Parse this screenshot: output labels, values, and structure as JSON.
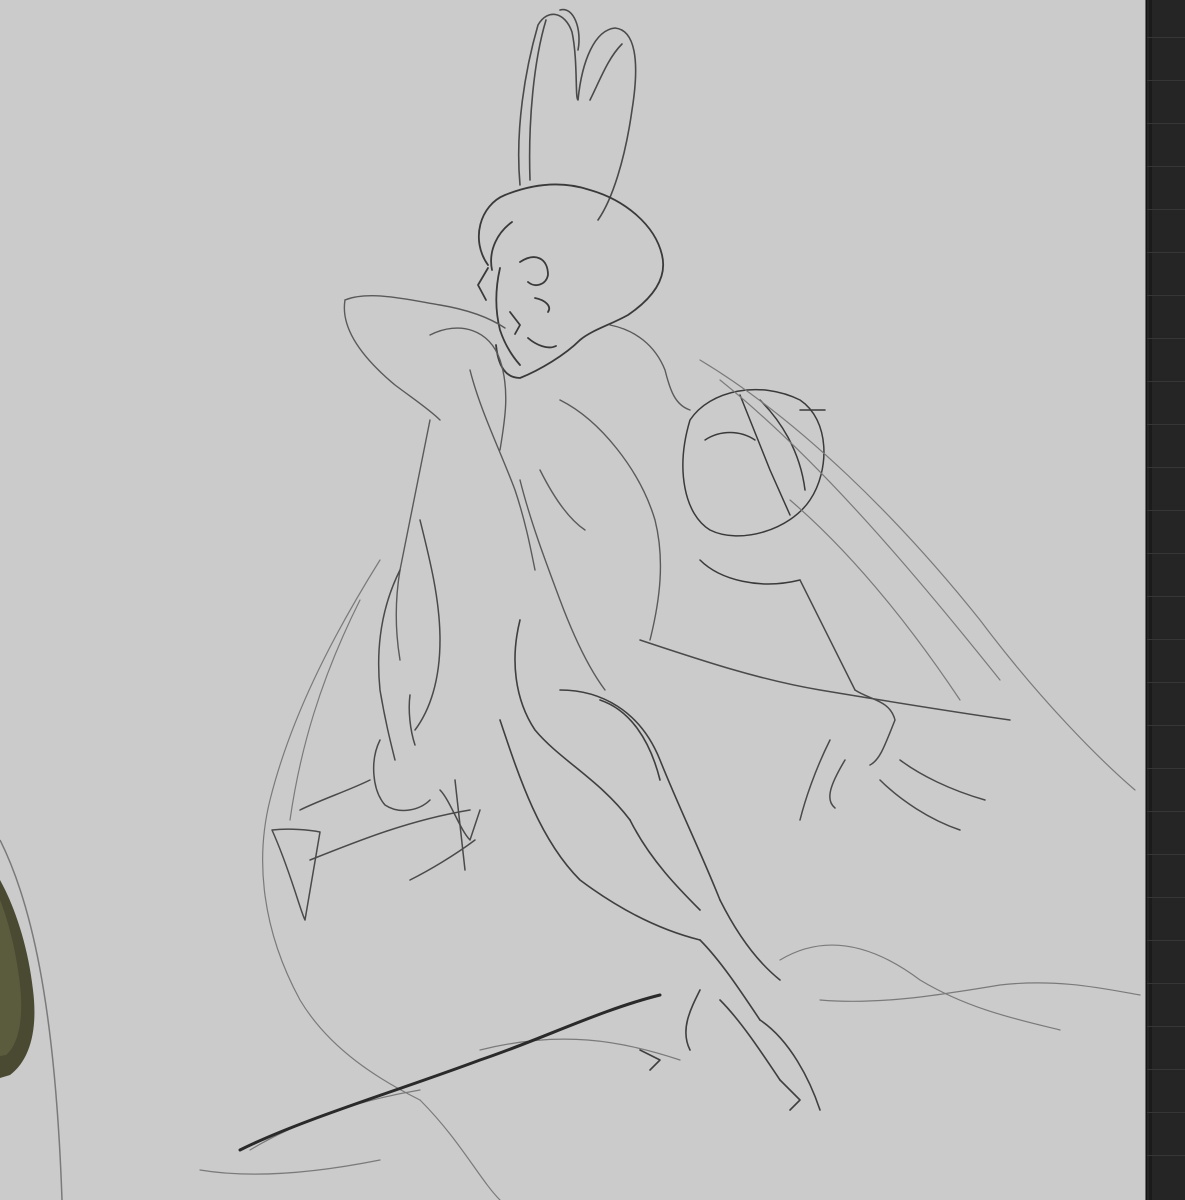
{
  "app": {
    "canvas": {
      "background_color": "#cbcbcb",
      "stroke_color": "#3f3f3f",
      "light_stroke_color": "#8a8a8a",
      "adjacent_artwork_color": "#4a4a33"
    },
    "right_panel": {
      "background_color": "#252525"
    }
  }
}
